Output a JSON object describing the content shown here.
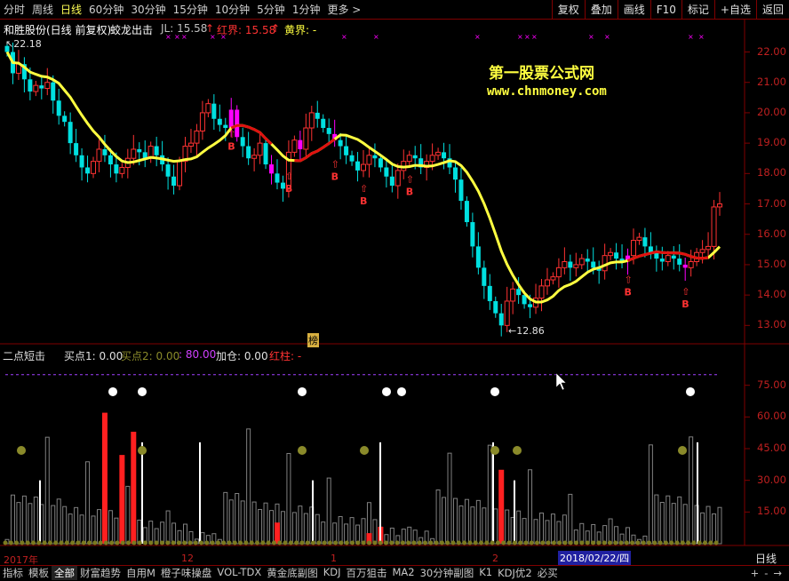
{
  "period_tabs": [
    "分时",
    "周线",
    "日线",
    "60分钟",
    "30分钟",
    "15分钟",
    "10分钟",
    "5分钟",
    "1分钟",
    "更多 >"
  ],
  "active_period": "日线",
  "toolbar_right": [
    "复权",
    "叠加",
    "画线",
    "F10",
    "标记",
    "+自选",
    "返回"
  ],
  "stock_title": "和胜股份(日线 前复权)",
  "indicator_name": "蛟龙出击",
  "jl_label": "JL: 15.58",
  "jl_arrow": "↑",
  "hongjie_label": "红界: 15.58",
  "hongjie_arrow": "↑",
  "huangjie_label": "黄界: -",
  "high_label": "22.18",
  "low_label": "12.86",
  "buy_marker": "B",
  "bang_label": "榜",
  "watermark_title": "第一股票公式网",
  "watermark_url": "www.chnmoney.com",
  "price_axis": [
    "22.00",
    "21.00",
    "20.00",
    "19.00",
    "18.00",
    "17.00",
    "16.00",
    "15.00",
    "14.00",
    "13.00"
  ],
  "sub_panel": {
    "name": "二点短击",
    "buy1": "买点1: 0.00",
    "buy2": "买点2: 0.00",
    "eighty": ": 80.00",
    "add": "加仓: 0.00",
    "red": "红柱: -",
    "axis": [
      "75.00",
      "60.00",
      "45.00",
      "30.00",
      "15.00"
    ]
  },
  "x_labels": [
    "2017年",
    "12",
    "1",
    "2"
  ],
  "date_cursor": "2018/02/22/四",
  "bottom_tabs": [
    "指标",
    "模板",
    "全部",
    "财富趋势",
    "自用M",
    "橙子味操盘",
    "VOL-TDX",
    "黄金底副图",
    "KDJ",
    "百万狙击",
    "MA2",
    "30分钟副图",
    "K1",
    "KDJ优2",
    "必买"
  ],
  "active_bottom_tab": "全部",
  "bottom_right": [
    "日线"
  ],
  "nav_buttons": [
    "+",
    "-",
    "→"
  ],
  "colors": {
    "up": "#ff3232",
    "down": "#00e0e0",
    "ma_yellow": "#ffff40",
    "ma_red": "#e01010",
    "magenta": "#ff00ff",
    "olive": "#8a8a2a"
  },
  "chart_data": {
    "type": "candlestick",
    "title": "和胜股份(日线 前复权)",
    "ylim": [
      12.6,
      22.6
    ],
    "closes": [
      22.0,
      21.3,
      21.6,
      21.1,
      20.7,
      20.9,
      20.8,
      21.0,
      20.4,
      19.9,
      19.7,
      19.0,
      18.6,
      18.2,
      18.0,
      18.4,
      18.8,
      18.6,
      18.3,
      18.0,
      18.2,
      18.5,
      18.8,
      18.7,
      18.5,
      18.9,
      18.6,
      18.3,
      17.9,
      17.6,
      18.4,
      18.9,
      19.0,
      19.4,
      20.0,
      20.3,
      19.8,
      19.6,
      19.5,
      20.1,
      19.2,
      18.9,
      18.5,
      18.6,
      19.0,
      18.3,
      18.0,
      17.7,
      17.5,
      18.7,
      19.1,
      18.8,
      19.5,
      20.0,
      19.8,
      19.5,
      19.3,
      19.1,
      18.9,
      18.6,
      18.4,
      18.1,
      18.3,
      18.6,
      18.5,
      18.2,
      17.9,
      17.6,
      18.1,
      18.4,
      18.6,
      18.5,
      18.2,
      18.4,
      18.6,
      18.7,
      18.5,
      18.2,
      17.8,
      17.1,
      16.4,
      15.6,
      14.9,
      14.3,
      13.8,
      13.4,
      13.0,
      13.8,
      14.2,
      14.0,
      13.7,
      13.6,
      13.9,
      14.3,
      14.5,
      14.6,
      14.9,
      15.1,
      14.9,
      15.0,
      15.2,
      15.1,
      14.9,
      14.8,
      15.3,
      15.4,
      15.2,
      15.1,
      15.3,
      15.8,
      15.9,
      15.6,
      15.4,
      15.2,
      15.1,
      15.3,
      15.2,
      15.0,
      14.9,
      15.1,
      15.4,
      15.5,
      15.6,
      16.9,
      17.0
    ],
    "ma_note": "yellow-red band line"
  }
}
